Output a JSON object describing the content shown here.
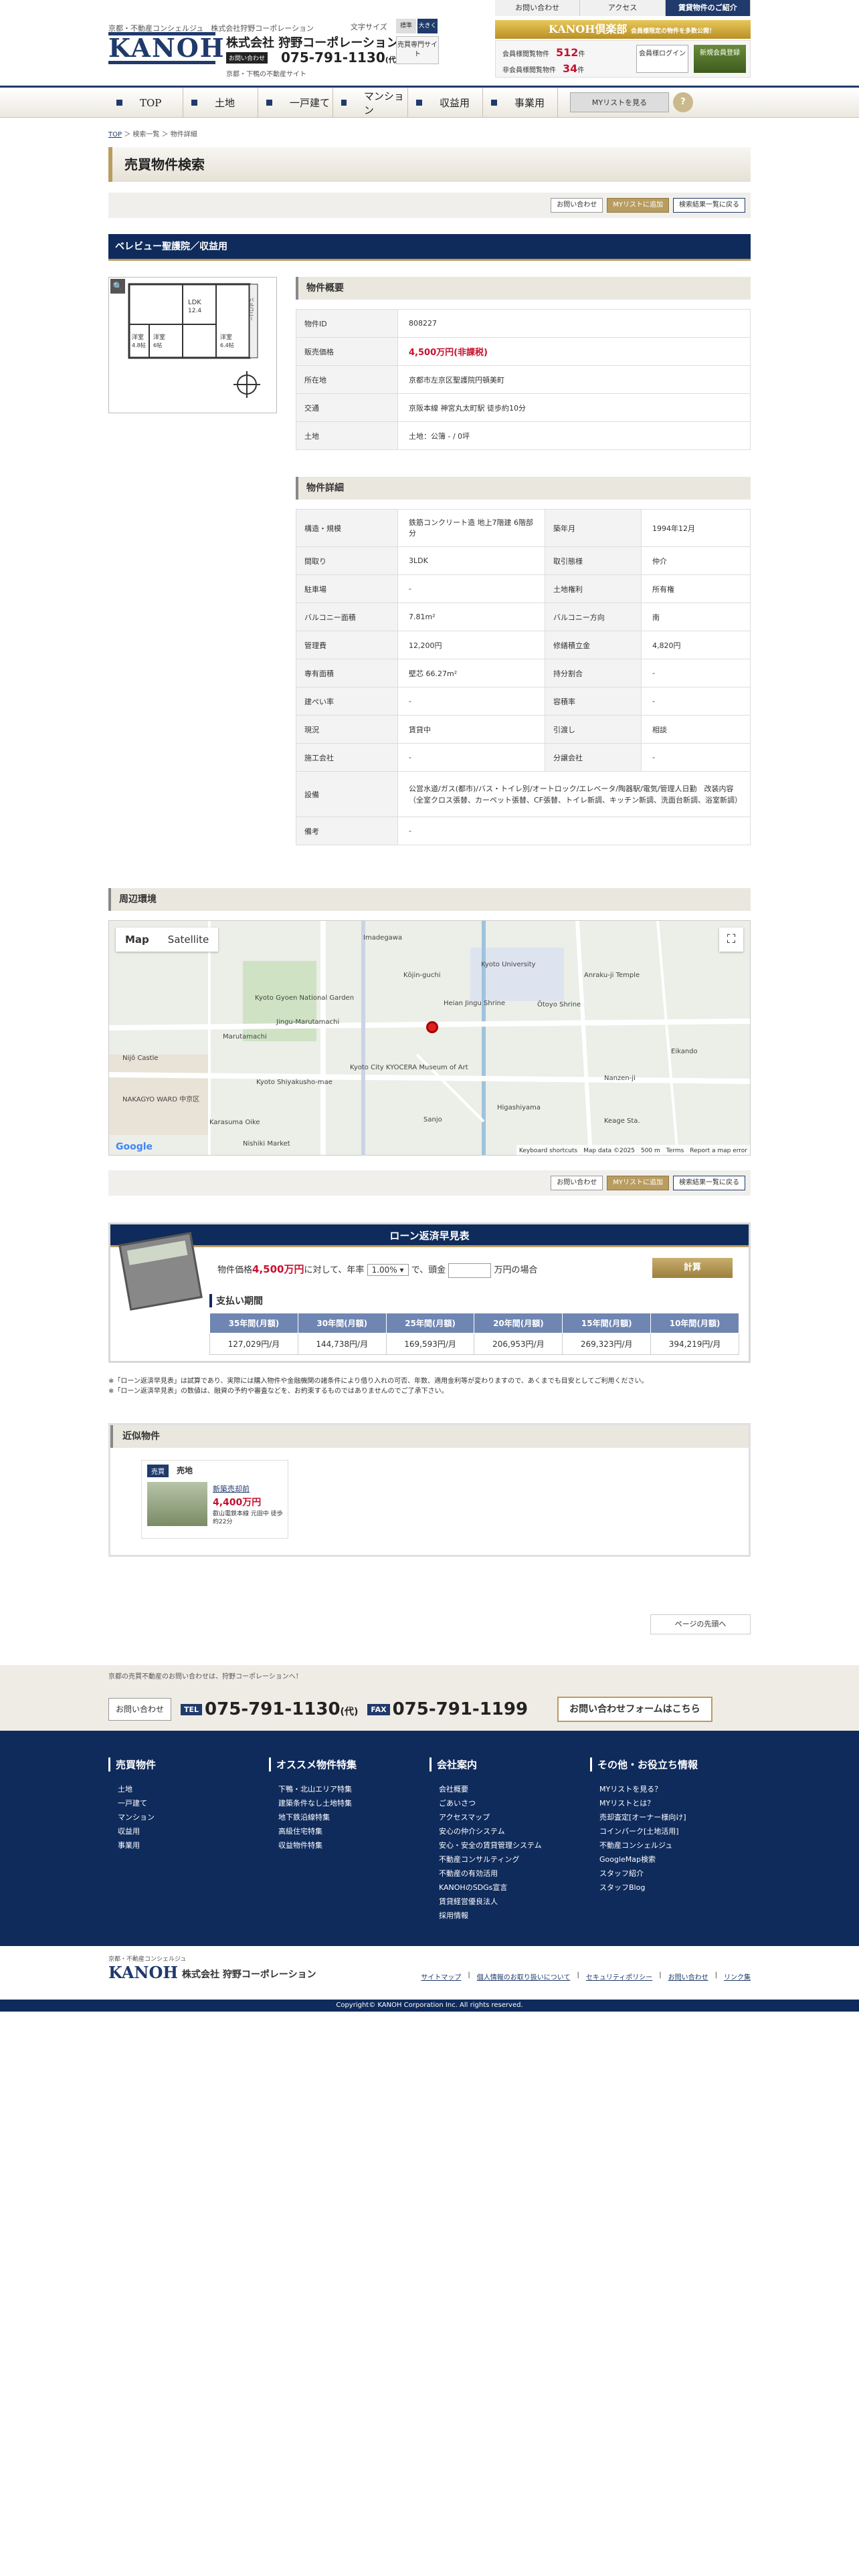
{
  "header": {
    "tagline": "京都・不動産コンシェルジュ　株式会社狩野コーポレーション",
    "logo": "KANOH",
    "company": "株式会社 狩野コーポレーション",
    "phone_tag": "お問い合わせ",
    "phone": "075-791-1130",
    "phone_suffix": "(代)",
    "site_sub": "京都・下鴨の不動産サイト",
    "font_size_label": "文字サイズ",
    "font_std": "標準",
    "font_big": "大きく",
    "expert": "売買専門サイト",
    "top_links": [
      "お問い合わせ",
      "アクセス",
      "賃貸物件のご紹介"
    ],
    "club": "KANOH倶楽部",
    "club_sub": "会員様限定の物件を多数公開！",
    "count1_label": "会員様閲覧物件",
    "count1_value": "512",
    "count1_unit": "件",
    "count2_label": "非会員様閲覧物件",
    "count2_value": "34",
    "count2_unit": "件",
    "login": "会員様ログイン",
    "register": "新規会員登録"
  },
  "nav": {
    "items": [
      "TOP",
      "土地",
      "一戸建て",
      "マンション",
      "収益用",
      "事業用"
    ],
    "mylist": "MYリストを見る",
    "help": "?"
  },
  "crumb": {
    "top": "TOP",
    "sep1": "＞",
    "list": "検索一覧",
    "sep2": "＞",
    "current": "物件詳細"
  },
  "page_title": "売買物件検索",
  "actions": {
    "inquiry": "お問い合わせ",
    "mylist_add": "MYリストに追加",
    "back": "検索結果一覧に戻る"
  },
  "property_name": "ベレビュー聖護院／収益用",
  "floorplan": {
    "zoom": "🔍",
    "ldk": "LDK",
    "ldk_size": "12.4",
    "room_label": "洋室",
    "room1": "4.8帖",
    "room2": "6帖",
    "room3": "6.4帖",
    "balcony": "バルコニー"
  },
  "overview": {
    "title": "物件概要",
    "rows": [
      {
        "k": "物件ID",
        "v": "808227"
      },
      {
        "k": "販売価格",
        "v": "4,500万円(非課税)"
      },
      {
        "k": "所在地",
        "v": "京都市左京区聖護院円頓美町"
      },
      {
        "k": "交通",
        "v": "京阪本線 神宮丸太町駅 徒歩約10分"
      },
      {
        "k": "土地",
        "v": "土地：公簿 - / 0坪"
      }
    ]
  },
  "details": {
    "title": "物件詳細",
    "rows": [
      {
        "k1": "構造・規模",
        "v1": "鉄筋コンクリート造 地上7階建 6階部分",
        "k2": "築年月",
        "v2": "1994年12月"
      },
      {
        "k1": "間取り",
        "v1": "3LDK",
        "k2": "取引態様",
        "v2": "仲介"
      },
      {
        "k1": "駐車場",
        "v1": "-",
        "k2": "土地権利",
        "v2": "所有権"
      },
      {
        "k1": "バルコニー面積",
        "v1": "7.81m²",
        "k2": "バルコニー方向",
        "v2": "南"
      },
      {
        "k1": "管理費",
        "v1": "12,200円",
        "k2": "修繕積立金",
        "v2": "4,820円"
      },
      {
        "k1": "専有面積",
        "v1": "壁芯 66.27m²",
        "k2": "持分割合",
        "v2": "-"
      },
      {
        "k1": "建ぺい率",
        "v1": "-",
        "k2": "容積率",
        "v2": "-"
      },
      {
        "k1": "現況",
        "v1": "賃貸中",
        "k2": "引渡し",
        "v2": "相談"
      },
      {
        "k1": "施工会社",
        "v1": "-",
        "k2": "分譲会社",
        "v2": "-"
      }
    ],
    "equip_k": "設備",
    "equip_v": "公営水道/ガス(都市)/バス・トイレ別/オートロック/エレベータ/陶器駅/電気/管理人日勤　改装内容（全室クロス張替、カーペット張替、CF張替、トイレ新調、キッチン新調、洗面台新調、浴室新調）",
    "note_k": "備考",
    "note_v": "-"
  },
  "surroundings": {
    "title": "周辺環境",
    "tab_map": "Map",
    "tab_sat": "Satellite",
    "fullscreen": "⛶",
    "labels": [
      "Kyoto Gyoen National Garden",
      "Heian Jingu Shrine",
      "Nijō Castle",
      "NAKAGYO WARD 中京区",
      "Kyoto City KYOCERA Museum of Art",
      "Ōtoyo Shrine",
      "Kyoto Shiyakusho-mae",
      "Marutamachi",
      "Jingu-Marutamachi",
      "Higashiyama",
      "Keage Sta.",
      "Nanzen-ji",
      "Kyoto University",
      "Eikando",
      "Karasuma Oike",
      "Anraku-ji Temple",
      "Nishiki Market",
      "Sanjo",
      "Kōjin-guchi",
      "Imadegawa"
    ],
    "google": "Google",
    "attribution": "Keyboard shortcuts　Map data ©2025　500 m　Terms　Report a map error"
  },
  "loan": {
    "title": "ローン返済早見表",
    "l1a": "物件価格",
    "price": "4,500万円",
    "l1b": "に対して、年率",
    "rate": "1.00% ▾",
    "l1c": "で、頭金",
    "l1d": "万円の場合",
    "calc": "計算",
    "period_title": "支払い期間",
    "headers": [
      "35年間(月額)",
      "30年間(月額)",
      "25年間(月額)",
      "20年間(月額)",
      "15年間(月額)",
      "10年間(月額)"
    ],
    "values": [
      "127,029円/月",
      "144,738円/月",
      "169,593円/月",
      "206,953円/月",
      "269,323円/月",
      "394,219円/月"
    ]
  },
  "notes": [
    "※「ローン返済早見表」は試算であり、実際には購入物件や金融機関の諸条件により借り入れの可否、年数、適用金利等が変わりますので、あくまでも目安としてご利用ください。",
    "※「ローン返済早見表」の数値は、融資の予約や審査などを、お約束するものではありませんのでご了承下さい。"
  ],
  "similar": {
    "title": "近似物件",
    "tag": "売買",
    "type": "売地",
    "name": "新築売却前",
    "price": "4,400万円",
    "addr": "叡山電鉄本線 元田中 徒歩約22分"
  },
  "pagetop": "ページの先頭へ",
  "bottom": {
    "msg": "京都の売買不動産のお問い合わせは、狩野コーポレーションへ！",
    "inquiry": "お問い合わせ",
    "tel_label": "TEL",
    "tel": "075-791-1130",
    "tel_suffix": "(代)",
    "fax_label": "FAX",
    "fax": "075-791-1199",
    "form": "お問い合わせフォームはこちら"
  },
  "footer": {
    "cols": [
      {
        "title": "売買物件",
        "items": [
          "土地",
          "一戸建て",
          "マンション",
          "収益用",
          "事業用"
        ]
      },
      {
        "title": "オススメ物件特集",
        "items": [
          "下鴨・北山エリア特集",
          "建築条件なし土地特集",
          "地下鉄沿線特集",
          "高級住宅特集",
          "収益物件特集"
        ]
      },
      {
        "title": "会社案内",
        "items": [
          "会社概要",
          "ごあいさつ",
          "アクセスマップ",
          "安心の仲介システム",
          "安心・安全の賃貸管理システム",
          "不動産コンサルティング",
          "不動産の有効活用",
          "KANOHのSDGs宣言",
          "賃貸経営優良法人",
          "採用情報"
        ]
      },
      {
        "title": "その他・お役立ち情報",
        "items": [
          "MYリストを見る？",
          "MYリストとは？",
          "売却査定[オーナー様向け]",
          "コインパーク[土地活用]",
          "不動産コンシェルジュ",
          "GoogleMap検索",
          "スタッフ紹介",
          "スタッフBlog"
        ]
      }
    ],
    "logo_tag": "京都・不動産コンシェルジュ",
    "logo": "KANOH",
    "company": "株式会社 狩野コーポレーション",
    "links": [
      "サイトマップ",
      "個人情報のお取り扱いについて",
      "セキュリティポリシー",
      "お問い合わせ",
      "リンク集"
    ],
    "copyright": "Copyright© KANOH Corporation Inc. All rights reserved."
  }
}
